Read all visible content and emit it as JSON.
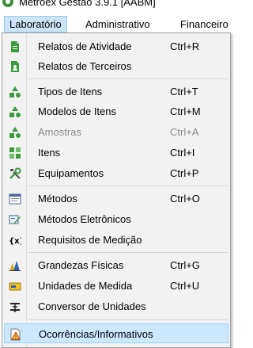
{
  "window": {
    "title": "Metroex Gestão 3.9.1 [AABM]"
  },
  "menubar": {
    "items": [
      {
        "label": "Laboratório"
      },
      {
        "label": "Administrativo"
      },
      {
        "label": "Financeiro"
      }
    ]
  },
  "menu": {
    "items": [
      {
        "label": "Relatos de Atividade",
        "shortcut": "Ctrl+R",
        "icon": "green-document-icon"
      },
      {
        "label": "Relatos de Terceiros",
        "shortcut": "",
        "icon": "green-document-person-icon"
      },
      {
        "label": "Tipos de Itens",
        "shortcut": "Ctrl+T",
        "icon": "green-shapes-icon"
      },
      {
        "label": "Modelos de Itens",
        "shortcut": "Ctrl+M",
        "icon": "green-shapes-icon"
      },
      {
        "label": "Amostras",
        "shortcut": "Ctrl+A",
        "icon": "green-shapes-icon",
        "disabled": true
      },
      {
        "label": "Itens",
        "shortcut": "Ctrl+I",
        "icon": "green-blocks-icon"
      },
      {
        "label": "Equipamentos",
        "shortcut": "Ctrl+P",
        "icon": "tools-icon"
      },
      {
        "label": "Métodos",
        "shortcut": "Ctrl+O",
        "icon": "method-window-icon"
      },
      {
        "label": "Métodos Eletrônicos",
        "shortcut": "",
        "icon": "electronic-method-icon"
      },
      {
        "label": "Requisitos de Medição",
        "shortcut": "",
        "icon": "variable-x-icon"
      },
      {
        "label": "Grandezas Físicas",
        "shortcut": "Ctrl+G",
        "icon": "physical-quantities-icon"
      },
      {
        "label": "Unidades de Medida",
        "shortcut": "Ctrl+U",
        "icon": "unit-tag-icon"
      },
      {
        "label": "Conversor de Unidades",
        "shortcut": "",
        "icon": "converter-icon"
      },
      {
        "label": "Ocorrências/Informativos",
        "shortcut": "",
        "icon": "warning-document-icon",
        "selected": true
      }
    ]
  },
  "colors": {
    "highlight": "#cce8ff",
    "menubar_active": "#cce4f7",
    "icon_green": "#3c9a3c",
    "disabled_text": "#8a8a8a"
  }
}
